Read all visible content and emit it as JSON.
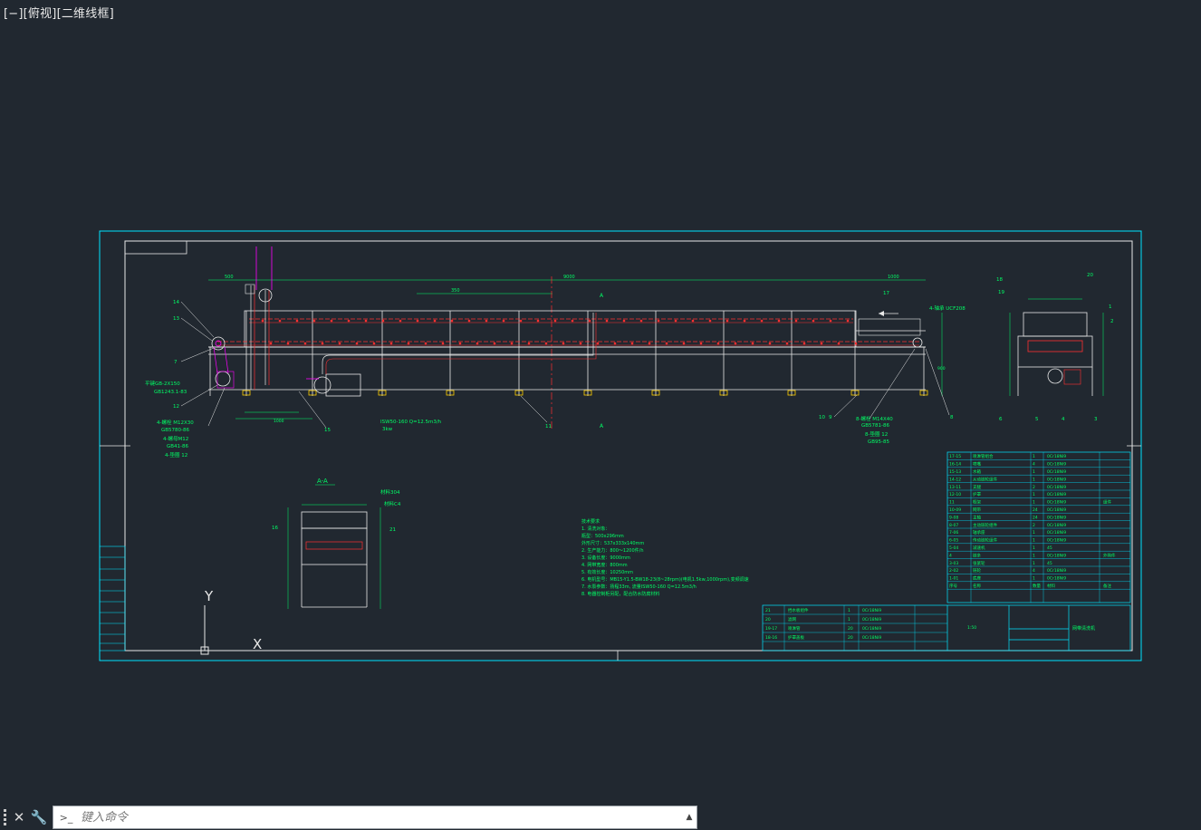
{
  "viewport": {
    "label": "[−][俯视][二维线框]"
  },
  "command": {
    "placeholder": "键入命令",
    "close_glyph": "✕",
    "settings_glyph": "🔧",
    "prompt_glyph": ">_",
    "history_glyph": "▲"
  },
  "drawing": {
    "dim_total": "9000",
    "dim_right": "1000",
    "dim_left": "500",
    "dim_pitch": "350",
    "dim_bottom": "1000",
    "dim_h": "900",
    "section_a": "A",
    "section_aa": "A-A",
    "labels": {
      "l14": "14",
      "l13": "13",
      "l7": "7",
      "l12": "12",
      "l15": "15",
      "l11": "11",
      "l10": "10",
      "l9": "9",
      "l8": "8",
      "l17": "17",
      "l16": "16",
      "l21": "21",
      "l18": "18",
      "l19": "19",
      "l20": "20",
      "l1": "1",
      "l2": "2",
      "l3": "3",
      "l4": "4",
      "l5": "5",
      "l6": "6"
    },
    "callouts": {
      "bearing": "4-轴承 UCF208",
      "pump": "ISW50-160 Q=12.5m3/h",
      "pump2": "3kw",
      "bolt": "8-螺栓 M14X40",
      "bolt_std": "GB5781-86",
      "washer": "8-垫圈 12",
      "washer_std": "GB95-85",
      "chain": "4-螺栓 M12X30",
      "chain_std": "GB5780-86",
      "nut": "4-螺母M12",
      "nut_std": "GB41-86",
      "washer2": "4-垫圈 12",
      "left_key": "平键GB-2X150",
      "left_key_std": "GB1243.1-83",
      "mat1": "材料304",
      "mat2": "材料C4"
    },
    "notes": [
      "技术要求",
      "1. 清洗对象：",
      "  瓶型：500x296mm",
      "  外形尺寸：537x333x140mm",
      "2. 生产能力：800～1200件/h",
      "3. 设备长度：9000mm",
      "4. 网带宽度：800mm",
      "5. 有效长度：10250mm",
      "6. 电机型号：MB15-Y1.5-BW18-23(8~28rpm)(电机1.5kw,1000rpm),变频调速",
      "7. 水泵参数：扬程33m, 流量ISW50-160 Q=12.5m3/h",
      "8. 电器控制柜另配，配合防水防腐材料"
    ],
    "parts": [
      [
        "17-15",
        "喷淋管组合",
        "1",
        "0Cr18Ni9",
        ""
      ],
      [
        "16-14",
        "喷嘴",
        "4",
        "0Cr18Ni9",
        ""
      ],
      [
        "15-13",
        "水箱",
        "1",
        "0Cr18Ni9",
        ""
      ],
      [
        "14-12",
        "从动链轮组件",
        "1",
        "0Cr18Ni9",
        ""
      ],
      [
        "13-11",
        "支腿",
        "2",
        "0Cr18Ni9",
        ""
      ],
      [
        "12-10",
        "护罩",
        "1",
        "0Cr18Ni9",
        ""
      ],
      [
        "11",
        "框架",
        "1",
        "0Cr18Ni9",
        "组件"
      ],
      [
        "10-09",
        "网带",
        "24",
        "0Cr18Ni9",
        ""
      ],
      [
        "9-08",
        "主轴",
        "24",
        "0Cr18Ni9",
        ""
      ],
      [
        "8-07",
        "主动链轮组件",
        "2",
        "0Cr18Ni9",
        ""
      ],
      [
        "7-06",
        "轴承座",
        "1",
        "0Cr18Ni9",
        ""
      ],
      [
        "6-05",
        "传动链轮组件",
        "1",
        "0Cr18Ni9",
        ""
      ],
      [
        "5-04",
        "减速机",
        "1",
        "45",
        ""
      ],
      [
        "4",
        "链条",
        "1",
        "0Cr18Ni9",
        "外购件"
      ],
      [
        "3-03",
        "张紧轮",
        "1",
        "45",
        ""
      ],
      [
        "2-02",
        "链轮",
        "4",
        "0Cr18Ni9",
        ""
      ],
      [
        "1-01",
        "底座",
        "1",
        "0Cr18Ni9",
        ""
      ]
    ],
    "parts_header": [
      "序号",
      "名称",
      "数量",
      "材料",
      "备注"
    ],
    "lower_parts": [
      [
        "21",
        "挡水板组件",
        "1",
        "0Cr18Ni9"
      ],
      [
        "20",
        "滤网",
        "1",
        "0Cr18Ni9"
      ],
      [
        "19-17",
        "喷淋管",
        "20",
        "0Cr18Ni9"
      ],
      [
        "18-16",
        "护罩盖板",
        "20",
        "0Cr18Ni9"
      ]
    ],
    "title_block": {
      "name": "网带清洗机",
      "scale": "1:50"
    },
    "ucs": {
      "x": "X",
      "y": "Y"
    }
  }
}
